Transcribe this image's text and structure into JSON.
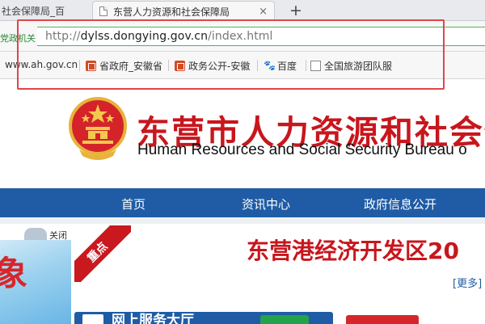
{
  "browser": {
    "tabs": [
      {
        "title": "社会保障局_百"
      },
      {
        "title": "东营人力资源和社会保障局"
      }
    ],
    "new_tab_symbol": "+",
    "close_symbol": "×",
    "left_label": "党政机关",
    "url_prefix": "http://",
    "url_host": "dylss.dongying.gov.cn",
    "url_path": "/index.html",
    "bookmarks": [
      {
        "label": "www.ah.gov.cn",
        "icon": "none"
      },
      {
        "label": "省政府_安徽省",
        "icon": "gov-icon"
      },
      {
        "label": "政务公开-安徽",
        "icon": "gov-icon"
      },
      {
        "label": "百度",
        "icon": "paw-icon"
      },
      {
        "label": "全国旅游团队服",
        "icon": "page-icon"
      }
    ]
  },
  "site": {
    "title_cn": "东营市人力资源和社会保",
    "title_en": "Human Resources and Social Security Bureau o",
    "nav": [
      "首页",
      "资讯中心",
      "政府信息公开"
    ],
    "close_label": "关闭",
    "ribbon_label": "重点",
    "headline": "东营港经济开发区20",
    "more_label": "[更多]",
    "service_title": "网上服务大厅"
  },
  "colors": {
    "brand_red": "#c8161d",
    "nav_blue": "#1f5ca5",
    "highlight": "#e0454a"
  }
}
